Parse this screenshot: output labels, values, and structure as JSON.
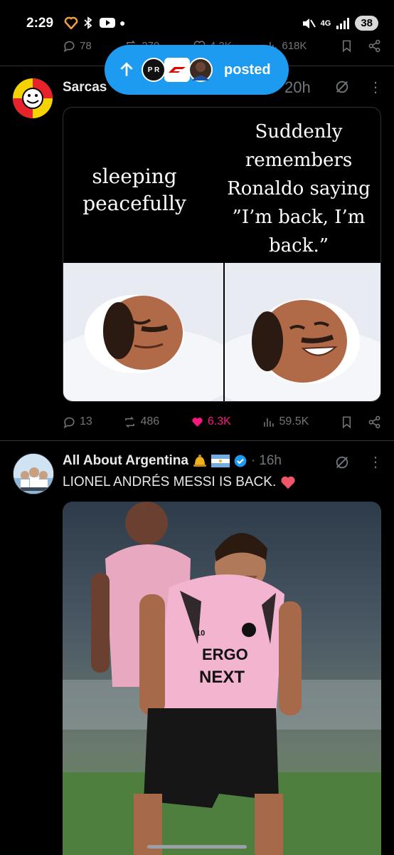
{
  "status_bar": {
    "time": "2:29",
    "network": "4G",
    "battery": "38"
  },
  "prev_tweet_stats": {
    "replies": "78",
    "reposts": "270",
    "likes": "4.2K",
    "views": "618K"
  },
  "posted_pill": {
    "label": "posted",
    "avatar1_text": "P R"
  },
  "tweet1": {
    "author": "Sarcas",
    "time": "20h",
    "more": "⋮",
    "meme_left_text": "sleeping peacefully",
    "meme_right_text": "Suddenly remembers Ronaldo saying ”I’m back, I’m back.”",
    "stats": {
      "replies": "13",
      "reposts": "486",
      "likes": "6.3K",
      "views": "59.5K"
    }
  },
  "tweet2": {
    "author": "All About Argentina",
    "separator": "·",
    "time": "16h",
    "more": "⋮",
    "text": "LIONEL ANDRÉS MESSI IS BACK.",
    "jersey_text_1": "ERGO",
    "jersey_text_2": "NEXT",
    "jersey_number": "10"
  },
  "colors": {
    "accent": "#1d9bf0",
    "like": "#f91880",
    "muted": "#71767b",
    "verified": "#1d9bf0"
  }
}
